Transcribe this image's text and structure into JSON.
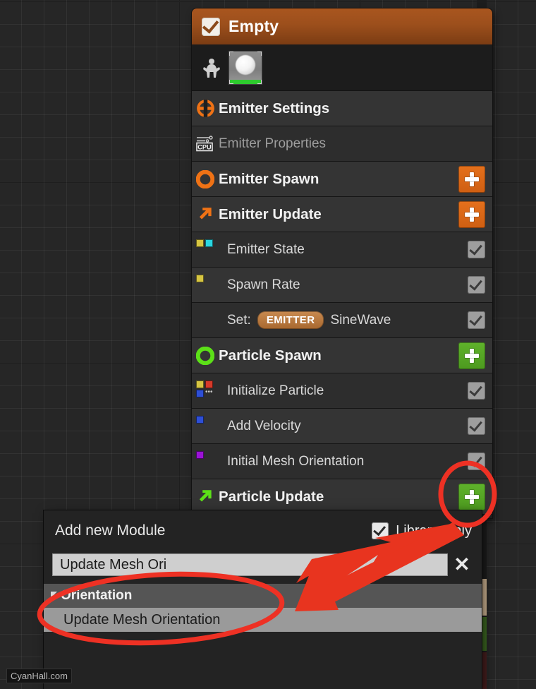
{
  "app": {
    "watermark": "CyanHall.com"
  },
  "emitter_panel": {
    "title": "Empty",
    "header_checkbox": "checked",
    "thumbnail_icon": "person-icon",
    "rows": [
      {
        "label": "Emitter Settings",
        "icon": "emitter-settings-icon",
        "kind": "section",
        "control": "none"
      },
      {
        "label": "Emitter Properties",
        "icon": "cpu-icon",
        "kind": "sub-dim",
        "control": "none"
      },
      {
        "label": "Emitter Spawn",
        "icon": "emitter-spawn-icon",
        "kind": "section",
        "control": "plus-orange"
      },
      {
        "label": "Emitter Update",
        "icon": "emitter-update-icon",
        "kind": "section",
        "control": "plus-orange"
      },
      {
        "label": "Emitter State",
        "icon": "swatch-yellow-cyan",
        "kind": "sub",
        "control": "checkbox"
      },
      {
        "label": "Spawn Rate",
        "icon": "swatch-yellow",
        "kind": "sub-alt",
        "control": "checkbox"
      },
      {
        "label": "Set:",
        "icon": "none",
        "kind": "sub",
        "control": "checkbox",
        "pill": "EMITTER",
        "trailing": "SineWave"
      },
      {
        "label": "Particle Spawn",
        "icon": "particle-spawn-icon",
        "kind": "section",
        "control": "plus-green"
      },
      {
        "label": "Initialize Particle",
        "icon": "swatch-multi",
        "kind": "sub",
        "control": "checkbox"
      },
      {
        "label": "Add Velocity",
        "icon": "swatch-blue",
        "kind": "sub-alt",
        "control": "checkbox"
      },
      {
        "label": "Initial Mesh Orientation",
        "icon": "swatch-purple",
        "kind": "sub",
        "control": "checkbox"
      },
      {
        "label": "Particle Update",
        "icon": "particle-update-icon",
        "kind": "section",
        "control": "plus-green"
      }
    ]
  },
  "add_module": {
    "title": "Add new Module",
    "library_only_label": "Library Only",
    "library_only_checked": "checked",
    "search_value": "Update Mesh Ori",
    "clear_icon": "close-icon",
    "categories": [
      {
        "name": "Orientation",
        "items": [
          "Update Mesh Orientation"
        ]
      }
    ]
  },
  "annotations": {
    "circle_plus": "red-ellipse-around-particle-update-plus",
    "circle_item": "red-ellipse-around-update-mesh-orientation",
    "arrow": "red-arrow-pointing-to-result-item"
  },
  "colors": {
    "header_orange": "#9c4f1c",
    "accent_orange": "#e4701c",
    "accent_green": "#5fb22b",
    "annotation_red": "#ee3124",
    "panel_bg": "#1f1f1f",
    "row_section": "#343434",
    "row_sub": "#2d2d2d"
  }
}
